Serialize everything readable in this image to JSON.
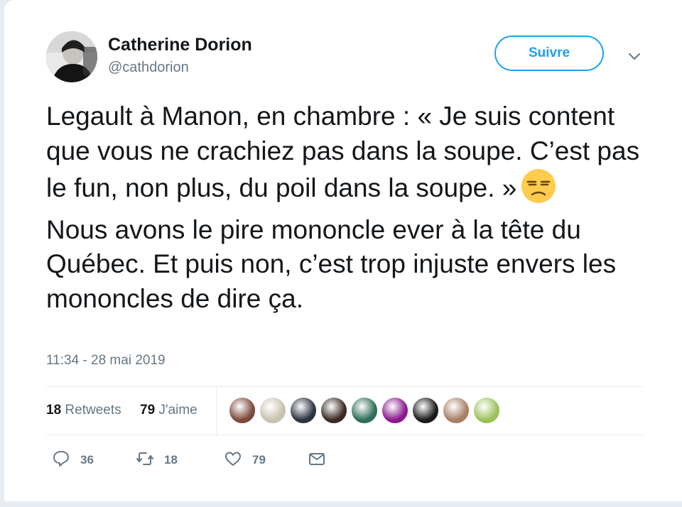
{
  "author": {
    "name": "Catherine Dorion",
    "handle": "@cathdorion",
    "follow_label": "Suivre"
  },
  "tweet": {
    "paragraph1": "Legault à Manon, en chambre : « Je suis content que vous ne crachiez pas dans la soupe. C’est pas le fun, non plus, du poil dans la soupe. »",
    "emoji": "unamused-face",
    "paragraph2": "Nous avons le pire mononcle ever à la tête du Québec. Et puis non, c’est trop injuste envers les mononcles de dire ça.",
    "timestamp": "11:34 - 28 mai 2019"
  },
  "stats": {
    "retweets_count": "18",
    "retweets_label": "Retweets",
    "likes_count": "79",
    "likes_label": "J'aime"
  },
  "likers": [
    {
      "name": "liker-avatar-1",
      "color": "#7a4a3a"
    },
    {
      "name": "liker-avatar-2",
      "color": "#c9c2b0"
    },
    {
      "name": "liker-avatar-3",
      "color": "#2b3440"
    },
    {
      "name": "liker-avatar-4",
      "color": "#3b2a22"
    },
    {
      "name": "liker-avatar-5",
      "color": "#2e6e5a"
    },
    {
      "name": "liker-avatar-6",
      "color": "#8a1a8e"
    },
    {
      "name": "liker-avatar-7",
      "color": "#1a1a1a"
    },
    {
      "name": "liker-avatar-8",
      "color": "#a88064"
    },
    {
      "name": "liker-avatar-9",
      "color": "#9cc25a"
    }
  ],
  "actions": {
    "reply_count": "36",
    "retweet_count": "18",
    "like_count": "79"
  },
  "colors": {
    "accent": "#1da1f2",
    "secondary_text": "#657786",
    "primary_text": "#14171a",
    "border": "#e6ecf0"
  }
}
